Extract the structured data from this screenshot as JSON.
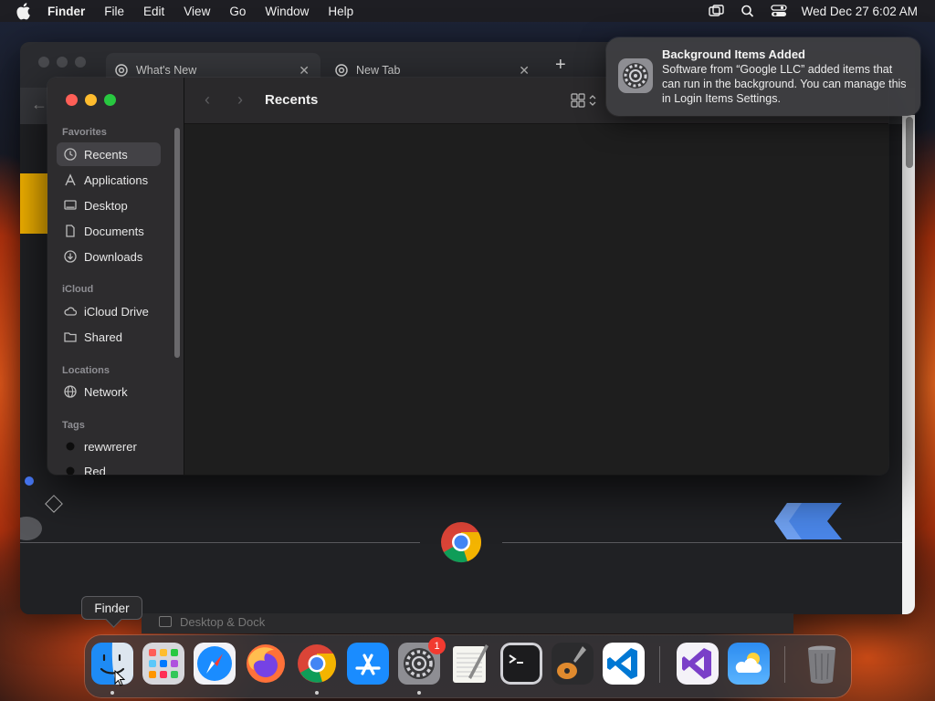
{
  "menubar": {
    "app_name": "Finder",
    "menus": [
      "File",
      "Edit",
      "View",
      "Go",
      "Window",
      "Help"
    ],
    "datetime": "Wed Dec 27  6:02 AM",
    "icons": [
      "apple-icon",
      "screen-mirroring-icon",
      "spotlight-search-icon",
      "control-center-icon"
    ]
  },
  "chrome": {
    "tabs": [
      {
        "label": "What's New"
      },
      {
        "label": "New Tab"
      }
    ],
    "close_glyph": "✕",
    "newtab_glyph": "+"
  },
  "finder": {
    "title": "Recents",
    "back_glyph": "‹",
    "forward_glyph": "›",
    "sidebar": {
      "favorites_label": "Favorites",
      "favorites": [
        {
          "label": "Recents",
          "icon": "clock-icon",
          "selected": true
        },
        {
          "label": "Applications",
          "icon": "applications-icon"
        },
        {
          "label": "Desktop",
          "icon": "desktop-icon"
        },
        {
          "label": "Documents",
          "icon": "document-icon"
        },
        {
          "label": "Downloads",
          "icon": "download-icon"
        }
      ],
      "icloud_label": "iCloud",
      "icloud": [
        {
          "label": "iCloud Drive",
          "icon": "cloud-icon"
        },
        {
          "label": "Shared",
          "icon": "shared-folder-icon"
        }
      ],
      "locations_label": "Locations",
      "locations": [
        {
          "label": "Network",
          "icon": "globe-icon"
        }
      ],
      "tags_label": "Tags",
      "tags": [
        {
          "label": "rewwrerer",
          "color": "#111111"
        },
        {
          "label": "Red",
          "color": "#111111"
        }
      ]
    }
  },
  "notification": {
    "title": "Background Items Added",
    "body": "Software from “Google LLC” added items that can run in the background. You can manage this in Login Items Settings.",
    "icon": "system-settings-icon"
  },
  "behind_dock": {
    "label": "Desktop & Dock"
  },
  "tooltip": {
    "label": "Finder"
  },
  "dock": {
    "apps": [
      {
        "name": "Finder",
        "icon": "finder-icon",
        "running": true
      },
      {
        "name": "Launchpad",
        "icon": "launchpad-icon"
      },
      {
        "name": "Safari",
        "icon": "safari-icon"
      },
      {
        "name": "Firefox",
        "icon": "firefox-icon"
      },
      {
        "name": "Google Chrome",
        "icon": "chrome-icon",
        "running": true
      },
      {
        "name": "App Store",
        "icon": "app-store-icon"
      },
      {
        "name": "System Settings",
        "icon": "system-settings-icon",
        "running": true,
        "badge": "1"
      },
      {
        "name": "TextEdit",
        "icon": "textedit-icon"
      },
      {
        "name": "Terminal",
        "icon": "terminal-icon"
      },
      {
        "name": "GarageBand",
        "icon": "garageband-icon"
      },
      {
        "name": "Visual Studio Code",
        "icon": "vscode-icon"
      },
      {
        "name": "Visual Studio",
        "icon": "visual-studio-icon"
      },
      {
        "name": "Weather",
        "icon": "weather-icon"
      },
      {
        "name": "Trash",
        "icon": "trash-icon"
      }
    ]
  }
}
